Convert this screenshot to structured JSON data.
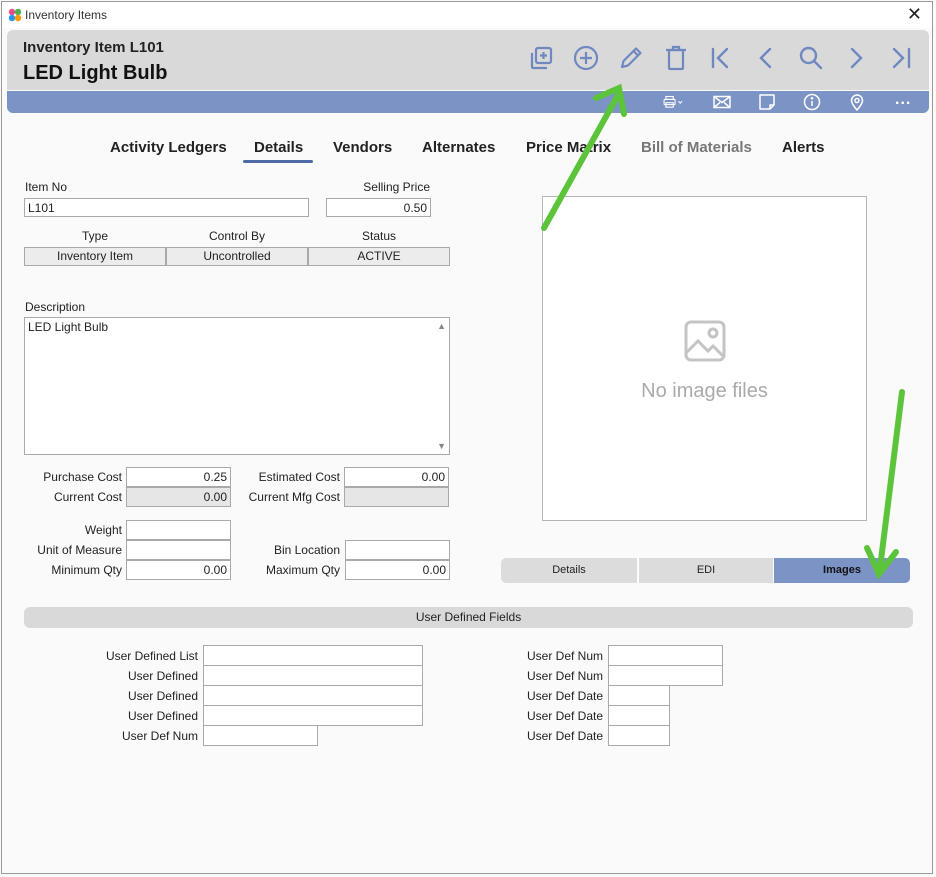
{
  "window": {
    "title": "Inventory Items",
    "close": "✕"
  },
  "header": {
    "subtitle": "Inventory Item L101",
    "title": "LED Light Bulb"
  },
  "toolbar": {
    "icons": [
      "copy-icon",
      "add-icon",
      "edit-icon",
      "delete-icon",
      "first-record-icon",
      "previous-record-icon",
      "search-icon",
      "next-record-icon",
      "last-record-icon"
    ],
    "secondary_icons": [
      "print-icon",
      "email-icon",
      "notes-icon",
      "info-icon",
      "location-icon"
    ],
    "more": "..."
  },
  "tabs": [
    {
      "label": "Activity Ledgers"
    },
    {
      "label": "Details"
    },
    {
      "label": "Vendors"
    },
    {
      "label": "Alternates"
    },
    {
      "label": "Price Matrix"
    },
    {
      "label": "Bill of Materials"
    },
    {
      "label": "Alerts"
    }
  ],
  "form": {
    "item_no_label": "Item No",
    "item_no": "L101",
    "selling_price_label": "Selling Price",
    "selling_price": "0.50",
    "type_label": "Type",
    "type": "Inventory Item",
    "control_by_label": "Control By",
    "control_by": "Uncontrolled",
    "status_label": "Status",
    "status": "ACTIVE",
    "description_label": "Description",
    "description": "LED Light Bulb",
    "purchase_cost_label": "Purchase Cost",
    "purchase_cost": "0.25",
    "current_cost_label": "Current Cost",
    "current_cost": "0.00",
    "estimated_cost_label": "Estimated Cost",
    "estimated_cost": "0.00",
    "current_mfg_cost_label": "Current Mfg Cost",
    "current_mfg_cost": "",
    "weight_label": "Weight",
    "weight": "",
    "unit_of_measure_label": "Unit of Measure",
    "unit_of_measure": "",
    "bin_location_label": "Bin Location",
    "bin_location": "",
    "minimum_qty_label": "Minimum Qty",
    "minimum_qty": "0.00",
    "maximum_qty_label": "Maximum Qty",
    "maximum_qty": "0.00"
  },
  "image_panel": {
    "empty_text": "No image files"
  },
  "segments": [
    {
      "label": "Details"
    },
    {
      "label": "EDI"
    },
    {
      "label": "Images"
    }
  ],
  "udf": {
    "title": "User Defined Fields",
    "left": [
      {
        "label": "User Defined List",
        "value": ""
      },
      {
        "label": "User Defined",
        "value": ""
      },
      {
        "label": "User Defined",
        "value": ""
      },
      {
        "label": "User Defined",
        "value": ""
      },
      {
        "label": "User Def Num",
        "value": ""
      }
    ],
    "right": [
      {
        "label": "User Def Num",
        "value": ""
      },
      {
        "label": "User Def Num",
        "value": ""
      },
      {
        "label": "User Def Date",
        "value": ""
      },
      {
        "label": "User Def Date",
        "value": ""
      },
      {
        "label": "User Def Date",
        "value": ""
      }
    ]
  },
  "colors": {
    "accent_blue": "#7b93c5",
    "icon_blue": "#6f88bf",
    "annotation_green": "#5cc43b",
    "header_gray": "#d9d9d9"
  }
}
